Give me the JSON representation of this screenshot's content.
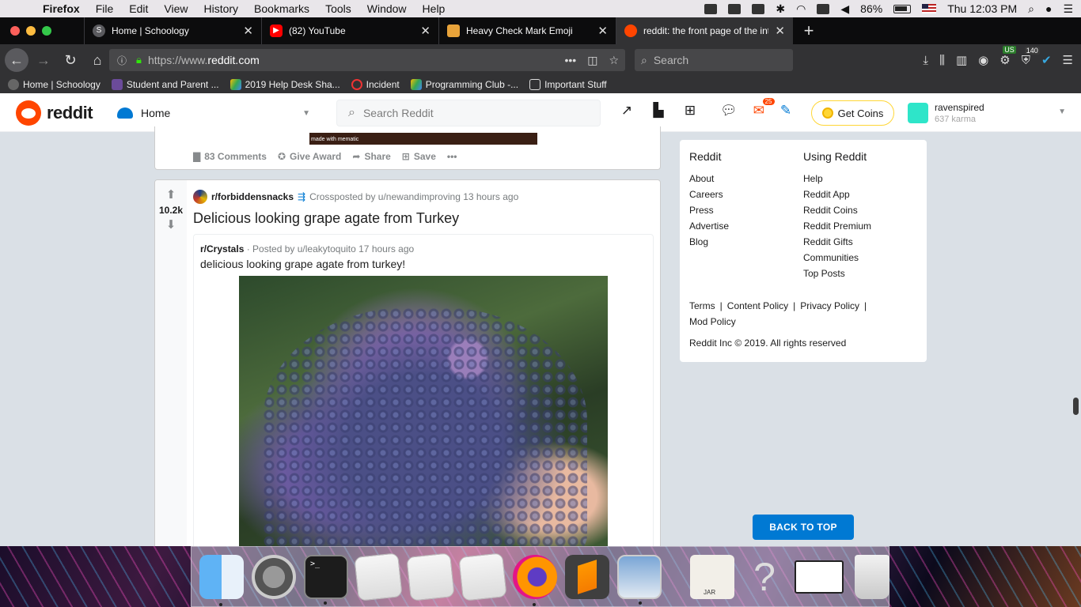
{
  "menubar": {
    "app_name": "Firefox",
    "items": [
      "File",
      "Edit",
      "View",
      "History",
      "Bookmarks",
      "Tools",
      "Window",
      "Help"
    ],
    "battery": "86%",
    "clock": "Thu 12:03 PM"
  },
  "tabs": [
    {
      "label": "Home | Schoology",
      "icon": "schoology-icon",
      "color": "#5a5a5e"
    },
    {
      "label": "(82) YouTube",
      "icon": "youtube-icon",
      "color": "#ff0000"
    },
    {
      "label": "Heavy Check Mark Emoji",
      "icon": "emojipedia-icon",
      "color": "#e8a33a"
    },
    {
      "label": "reddit: the front page of the internet",
      "icon": "reddit-icon",
      "color": "#ff4500",
      "active": true
    }
  ],
  "navbar": {
    "url_prefix": "https://www.",
    "url_domain": "reddit.com",
    "search_placeholder": "Search",
    "ext_badge_us": "US",
    "ext_badge_count": "140"
  },
  "bookmarks": [
    {
      "label": "Home | Schoology",
      "icon": "schoology-icon"
    },
    {
      "label": "Student and Parent ...",
      "icon": "p-icon"
    },
    {
      "label": "2019 Help Desk Sha...",
      "icon": "drive-icon"
    },
    {
      "label": "Incident",
      "icon": "incident-icon"
    },
    {
      "label": "Programming Club -...",
      "icon": "drive-icon"
    },
    {
      "label": "Important Stuff",
      "icon": "folder-icon"
    }
  ],
  "reddit_header": {
    "logo_text": "reddit",
    "feed_label": "Home",
    "search_placeholder": "Search Reddit",
    "mail_count": "25",
    "get_coins": "Get Coins",
    "username": "ravenspired",
    "karma": "637 karma"
  },
  "post1": {
    "meme_caption": "made with mematic",
    "comments": "83 Comments",
    "give_award": "Give Award",
    "share": "Share",
    "save": "Save"
  },
  "post2": {
    "score": "10.2k",
    "subreddit": "r/forbiddensnacks",
    "crossposted_by": "Crossposted by u/newandimproving 13 hours ago",
    "title": "Delicious looking grape agate from Turkey",
    "orig_subreddit": "r/Crystals",
    "orig_meta": "· Posted by u/leakytoquito 17 hours ago",
    "orig_title": "delicious looking grape agate from turkey!"
  },
  "sidebar": {
    "col1_head": "Reddit",
    "col1_links": [
      "About",
      "Careers",
      "Press",
      "Advertise",
      "Blog"
    ],
    "col2_head": "Using Reddit",
    "col2_links": [
      "Help",
      "Reddit App",
      "Reddit Coins",
      "Reddit Premium",
      "Reddit Gifts",
      "Communities",
      "Top Posts"
    ],
    "legal": [
      "Terms",
      "Content Policy",
      "Privacy Policy",
      "Mod Policy"
    ],
    "copyright": "Reddit Inc © 2019. All rights reserved"
  },
  "back_to_top": "BACK TO TOP",
  "dock": {
    "jar_label": "JAR",
    "question": "?"
  }
}
